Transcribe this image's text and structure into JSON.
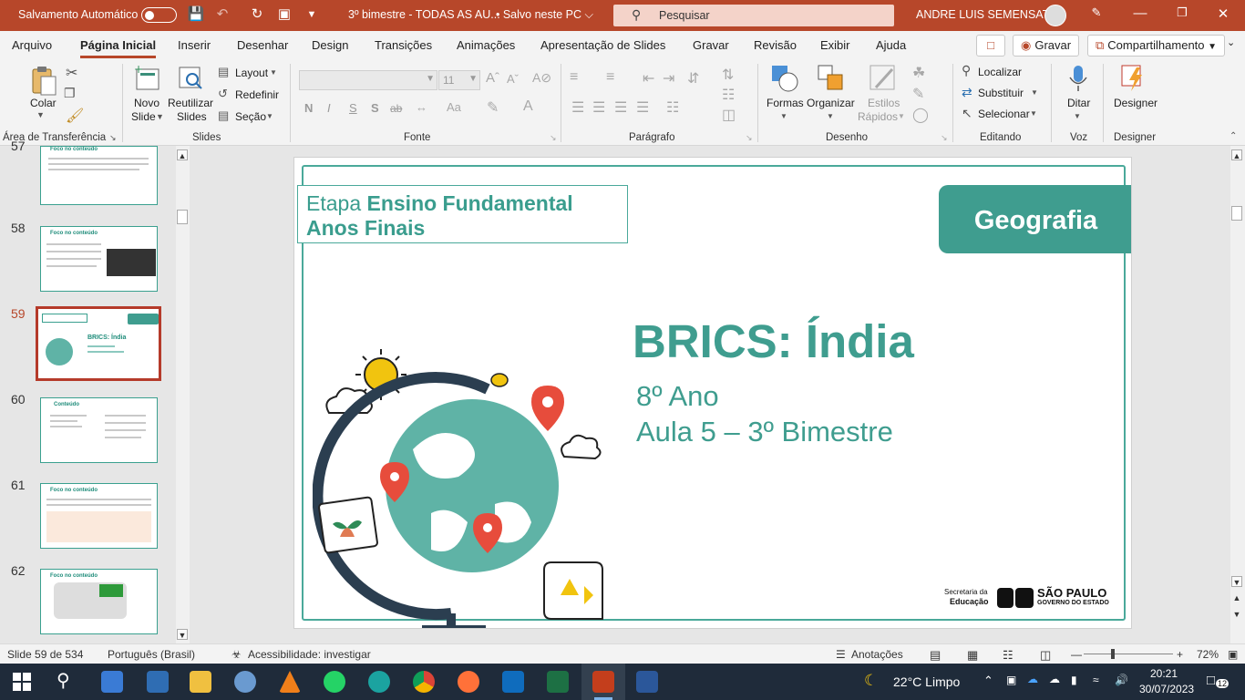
{
  "titlebar": {
    "autosave_label": "Salvamento Automático",
    "doc_title": "3º bimestre - TODAS AS AU...",
    "save_state": "• Salvo neste PC ⌵",
    "search_placeholder": "Pesquisar",
    "user_name": "ANDRE LUIS SEMENSATO",
    "bg_color": "#b7472a"
  },
  "tabs": {
    "items": [
      "Arquivo",
      "Página Inicial",
      "Inserir",
      "Desenhar",
      "Design",
      "Transições",
      "Animações",
      "Apresentação de Slides",
      "Gravar",
      "Revisão",
      "Exibir",
      "Ajuda"
    ],
    "active": "Página Inicial",
    "record_button": "Gravar",
    "share_button": "Compartilhamento"
  },
  "ribbon": {
    "clipboard": {
      "paste": "Colar",
      "label": "Área de Transferência"
    },
    "slides": {
      "new_slide_1": "Novo",
      "new_slide_2": "Slide",
      "reuse_1": "Reutilizar",
      "reuse_2": "Slides",
      "layout": "Layout",
      "reset": "Redefinir",
      "section": "Seção",
      "label": "Slides"
    },
    "font": {
      "size_value": "11",
      "bold": "N",
      "italic": "I",
      "underline": "S",
      "shadow": "S",
      "strike": "ab",
      "label": "Fonte"
    },
    "paragraph": {
      "label": "Parágrafo"
    },
    "drawing": {
      "shapes": "Formas",
      "arrange": "Organizar",
      "quick_styles_1": "Estilos",
      "quick_styles_2": "Rápidos",
      "label": "Desenho"
    },
    "editing": {
      "find": "Localizar",
      "replace": "Substituir",
      "select": "Selecionar",
      "label": "Editando"
    },
    "voice": {
      "dictate": "Ditar",
      "label": "Voz"
    },
    "designer": {
      "designer": "Designer",
      "label": "Designer"
    }
  },
  "slides_panel": {
    "thumbnails": [
      {
        "number": "57",
        "heading": "Foco no conteúdo"
      },
      {
        "number": "58",
        "heading": "Foco no conteúdo"
      },
      {
        "number": "59",
        "heading": "BRICS: Índia",
        "active": true
      },
      {
        "number": "60",
        "heading": "Conteúdo"
      },
      {
        "number": "61",
        "heading": "Foco no conteúdo"
      },
      {
        "number": "62",
        "heading": "Foco no conteúdo"
      }
    ]
  },
  "slide": {
    "etapa_prefix": "Etapa ",
    "etapa_bold": "Ensino Fundamental",
    "etapa_line2": "Anos Finais",
    "subject_badge": "Geografia",
    "title": "BRICS: Índia",
    "subtitle_1": "8º Ano",
    "subtitle_2": "Aula 5 – 3º Bimestre",
    "logo_text_1": "Secretaria da",
    "logo_text_2": "Educação",
    "logo_state_1": "SÃO PAULO",
    "logo_state_2": "GOVERNO DO ESTADO",
    "accent_color": "#3f9d8f"
  },
  "status": {
    "slide_counter": "Slide 59 de 534",
    "language": "Português (Brasil)",
    "accessibility": "Acessibilidade: investigar",
    "notes": "Anotações",
    "zoom": "72%"
  },
  "taskbar": {
    "weather": "22°C  Limpo",
    "time": "20:21",
    "date": "30/07/2023",
    "notifications": "12"
  }
}
